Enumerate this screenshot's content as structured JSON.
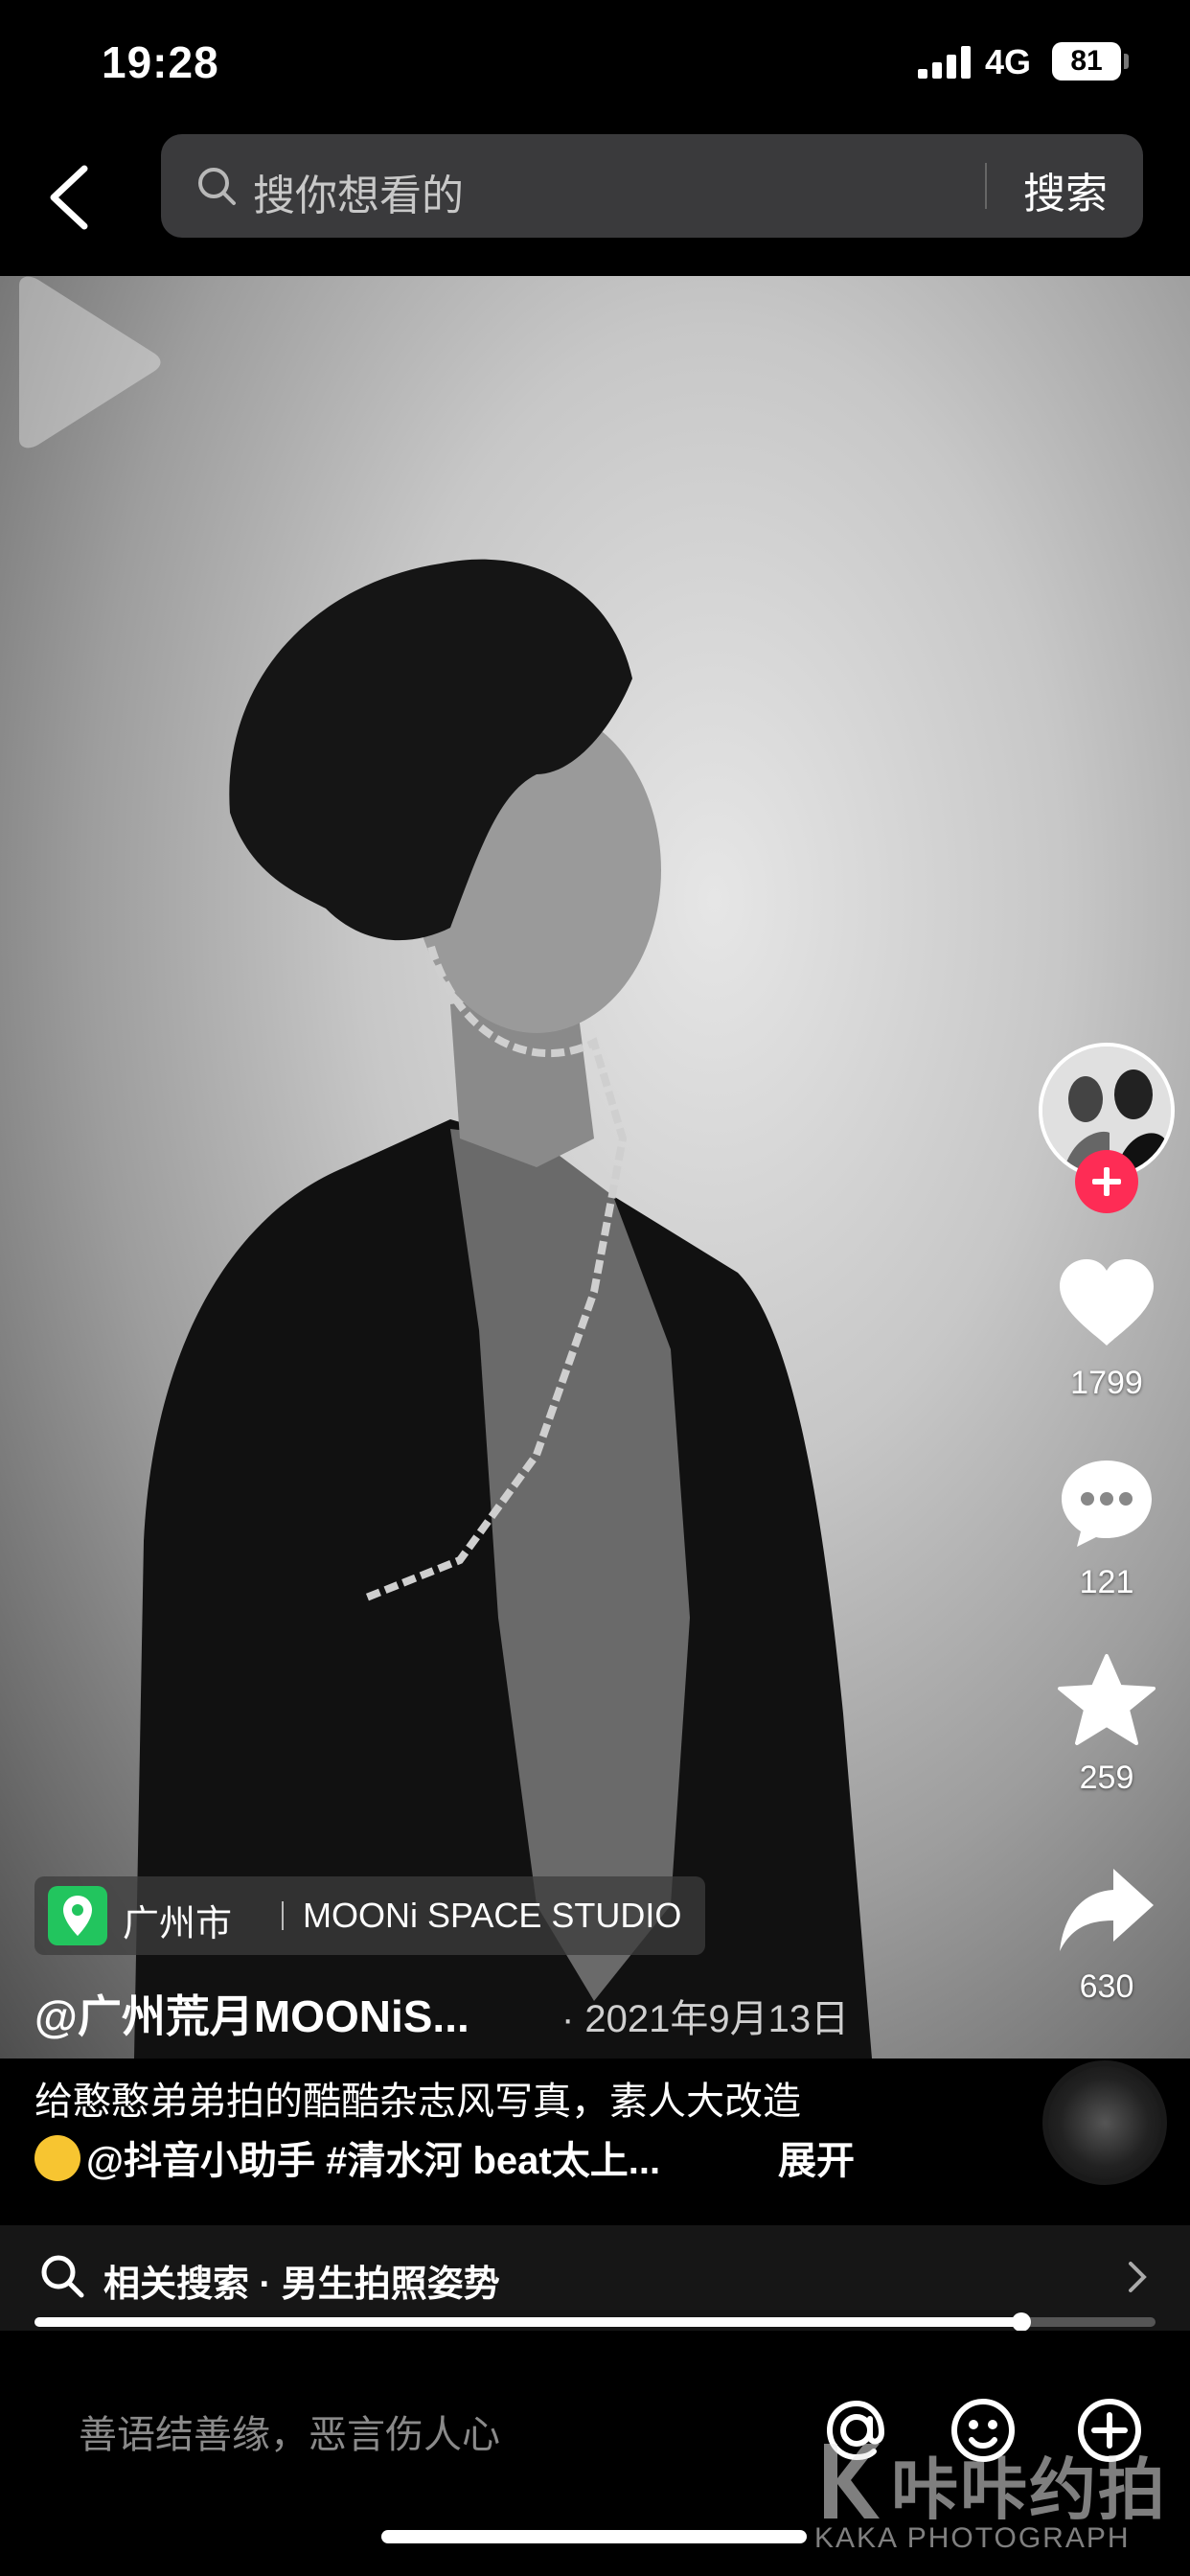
{
  "status_bar": {
    "time": "19:28",
    "network": "4G",
    "battery": "81"
  },
  "header": {
    "search_placeholder": "搜你想看的",
    "search_button": "搜索"
  },
  "actions": {
    "likes": "1799",
    "comments": "121",
    "favorites": "259",
    "shares": "630"
  },
  "location": {
    "city": "广州市",
    "studio": "MOONi SPACE STUDIO"
  },
  "post": {
    "author": "@广州荒月MOONiS...",
    "date": "· 2021年9月13日",
    "caption_line1": "给憨憨弟弟拍的酷酷杂志风写真，素人大改造",
    "caption_line2": "@抖音小助手 #清水河 beat太上...",
    "expand": "展开"
  },
  "related_search": {
    "text": "相关搜索 · 男生拍照姿势"
  },
  "progress": {
    "fraction": 0.88
  },
  "comment_bar": {
    "placeholder": "善语结善缘，恶言伤人心"
  },
  "watermark": {
    "brand": "咔咔约拍",
    "sub": "KAKA PHOTOGRAPH"
  },
  "colors": {
    "follow": "#fe2c55",
    "location_pin": "#22c55e",
    "search_bg": "#3a3a3c"
  }
}
